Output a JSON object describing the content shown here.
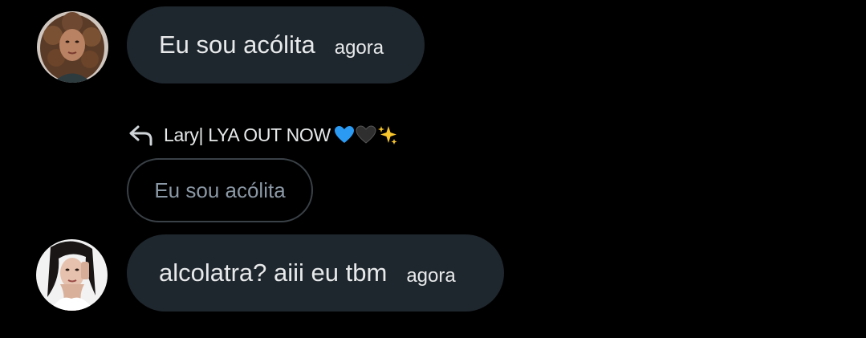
{
  "messages": [
    {
      "text": "Eu sou acólita",
      "time": "agora",
      "avatar_icon": "avatar-curly-hair-woman"
    },
    {
      "text": "alcolatra? aiii eu tbm",
      "time": "agora",
      "avatar_icon": "avatar-dark-hair-woman"
    }
  ],
  "reply": {
    "icon": "reply-arrow-icon",
    "to_name": "Lary| LYA OUT NOW",
    "emojis": [
      "blue-heart-icon",
      "black-heart-icon",
      "sparkles-icon"
    ],
    "quoted_text": "Eu sou acólita"
  },
  "colors": {
    "background": "#000000",
    "bubble": "#1f272e",
    "text": "#e7e9ea",
    "quoted_text": "#8b98a5",
    "quoted_border": "#3a4147"
  }
}
